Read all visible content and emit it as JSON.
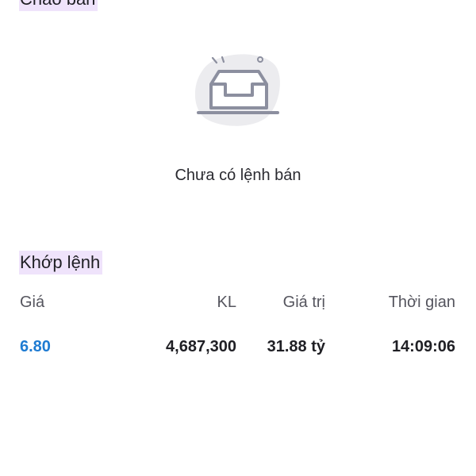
{
  "sections": {
    "offer_label": "Chào bán",
    "empty_message": "Chưa có lệnh bán",
    "match_label": "Khớp lệnh"
  },
  "match_table": {
    "headers": {
      "price": "Giá",
      "volume": "KL",
      "value": "Giá trị",
      "time": "Thời gian"
    },
    "rows": [
      {
        "price": "6.80",
        "volume": "4,687,300",
        "value": "31.88 tỷ",
        "time": "14:09:06"
      }
    ]
  },
  "colors": {
    "price_up": "#1e7bd2",
    "label_highlight": "#efe3fb",
    "empty_icon_stroke": "#8c8f9f",
    "empty_icon_blob": "#ececef"
  },
  "icons": {
    "empty": "empty-inbox-icon"
  }
}
